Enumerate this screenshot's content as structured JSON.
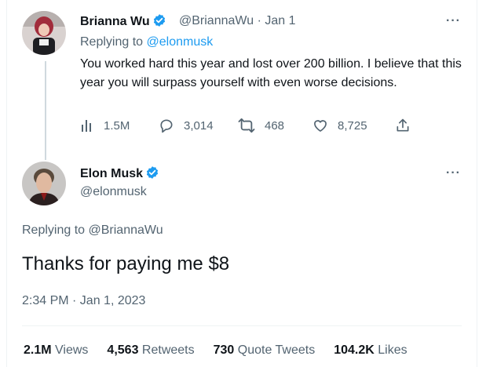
{
  "reply_tweet": {
    "author_name": "Brianna Wu",
    "handle": "@BriannaWu",
    "separator": "·",
    "date": "Jan 1",
    "replying_prefix": "Replying to",
    "replying_handle": "@elonmusk",
    "text": "You worked hard this year and lost over 200 billion. I believe that this year you will surpass yourself with even worse decisions.",
    "more": "···",
    "views": "1.5M",
    "replies": "3,014",
    "retweets": "468",
    "likes": "8,725"
  },
  "main_tweet": {
    "author_name": "Elon Musk",
    "handle": "@elonmusk",
    "more": "···",
    "replying_to": "Replying to @BriannaWu",
    "text": "Thanks for paying me $8",
    "timestamp": "2:34 PM · Jan 1, 2023",
    "stats": {
      "views_count": "2.1M",
      "views_label": "Views",
      "retweets_count": "4,563",
      "retweets_label": "Retweets",
      "quotes_count": "730",
      "quotes_label": "Quote Tweets",
      "likes_count": "104.2K",
      "likes_label": "Likes"
    }
  },
  "colors": {
    "accent": "#1d9bf0",
    "muted": "#536471",
    "text": "#0f1419",
    "border": "#eff3f4"
  },
  "icons": [
    "verified-badge-icon",
    "views-chart-icon",
    "reply-bubble-icon",
    "retweet-icon",
    "heart-icon",
    "share-icon",
    "more-icon"
  ]
}
